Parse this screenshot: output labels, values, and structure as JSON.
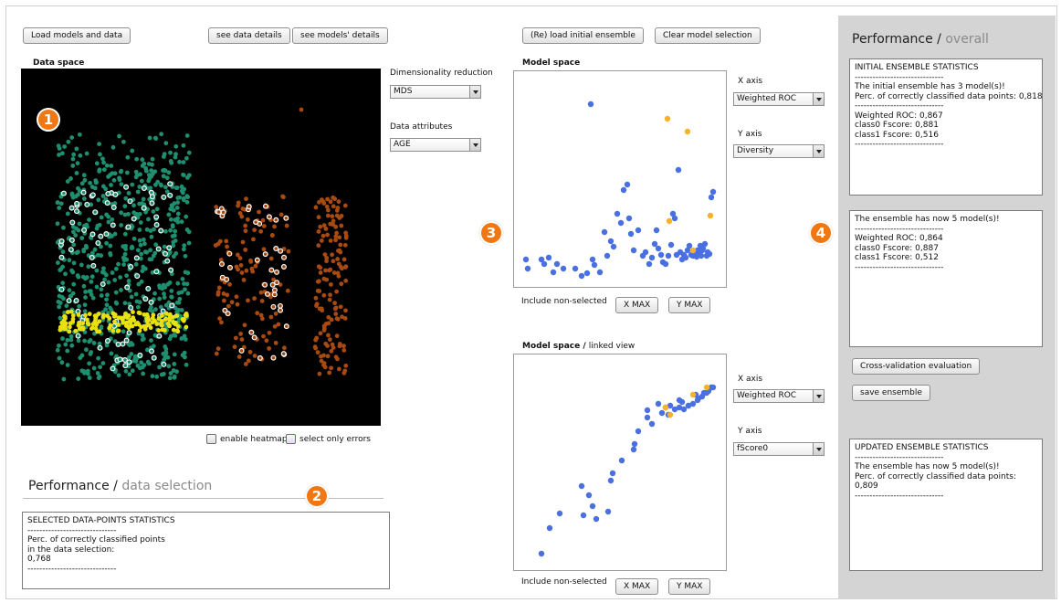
{
  "toolbar": {
    "load_models_data": "Load models and data",
    "see_data_details": "see data details",
    "see_models_details": "see models' details",
    "reload_initial_ensemble": "(Re) load initial ensemble",
    "clear_model_selection": "Clear model selection"
  },
  "data_space": {
    "title": "Data space",
    "dimensionality_label": "Dimensionality reduction",
    "dimensionality_value": "MDS",
    "attributes_label": "Data attributes",
    "attributes_value": "AGE",
    "enable_heatmap": "enable heatmap",
    "select_only_errors": "select only errors"
  },
  "model_space": {
    "title": "Model space",
    "x_axis_label": "X axis",
    "x_axis_value": "Weighted ROC",
    "y_axis_label": "Y axis",
    "y_axis_value": "Diversity",
    "include_non_selected": "Include non-selected",
    "x_max": "X MAX",
    "y_max": "Y MAX"
  },
  "linked_view": {
    "title": "Model space",
    "title_sep": " / ",
    "title_sub": "linked view",
    "x_axis_label": "X axis",
    "x_axis_value": "Weighted ROC",
    "y_axis_label": "Y axis",
    "y_axis_value": "fScore0",
    "include_non_selected": "Include non-selected",
    "x_max": "X MAX",
    "y_max": "Y MAX"
  },
  "performance_selection": {
    "header_main": "Performance",
    "header_sep": " / ",
    "header_sub": "data selection",
    "text": "SELECTED DATA-POINTS STATISTICS\n------------------------------\nPerc. of correctly classified points\nin the data selection:\n0,768\n------------------------------"
  },
  "performance_overall": {
    "header_main": "Performance",
    "header_sep": " / ",
    "header_sub": "overall",
    "initial_text": "INITIAL ENSEMBLE STATISTICS\n------------------------------\nThe initial ensemble has 3 model(s)!\nPerc. of correctly classified data points: 0,818\n------------------------------\nWeighted ROC: 0,867\nclass0 Fscore: 0,881\nclass1 Fscore: 0,516\n------------------------------",
    "current_text": "The ensemble has now 5 model(s)!\n------------------------------\nWeighted ROC: 0,864\nclass0 Fscore: 0,887\nclass1 Fscore: 0,512\n------------------------------",
    "cross_validation": "Cross-validation evaluation",
    "save_ensemble": "save ensemble",
    "updated_text": "UPDATED ENSEMBLE STATISTICS\n------------------------------\nThe ensemble has now 5 model(s)!\nPerc. of correctly classified data points:\n0,809\n------------------------------"
  },
  "markers": {
    "m1": "1",
    "m2": "2",
    "m3": "3",
    "m4": "4"
  },
  "colors": {
    "class_green": "#1e8e6e",
    "class_orange": "#a64a10",
    "selected_yellow": "#e8e010",
    "model_blue": "#4a6fe0",
    "model_selected": "#f5b22a",
    "marker_orange": "#f07814",
    "panel_gray": "#d4d4d4"
  },
  "chart_data": [
    {
      "type": "scatter",
      "title": "Model space",
      "xlabel": "",
      "ylabel": "",
      "series": [
        {
          "name": "",
          "color": "#4a6fe0",
          "x": [
            78,
            7,
            9,
            24,
            27,
            32,
            37,
            41,
            48,
            61,
            68,
            74,
            80,
            82,
            88,
            93,
            96,
            100,
            103,
            107,
            111,
            114,
            118,
            120,
            122,
            125,
            130,
            135,
            138,
            142,
            145,
            148,
            150,
            152,
            155,
            157,
            160,
            163,
            166,
            168,
            170,
            172,
            174,
            176,
            178,
            180,
            182,
            184,
            186,
            188,
            190,
            192,
            194,
            195,
            196,
            197,
            198,
            199,
            200,
            201,
            203,
            205,
            206,
            208,
            210,
            212
          ],
          "y": [
            30,
            200,
            210,
            200,
            205,
            198,
            214,
            205,
            210,
            210,
            218,
            215,
            200,
            206,
            214,
            170,
            196,
            180,
            186,
            150,
            160,
            124,
            118,
            155,
            172,
            190,
            168,
            196,
            192,
            205,
            198,
            183,
            168,
            188,
            195,
            203,
            205,
            196,
            184,
            150,
            155,
            195,
            102,
            192,
            200,
            195,
            198,
            190,
            185,
            195,
            196,
            192,
            197,
            190,
            190,
            195,
            185,
            196,
            190,
            188,
            183,
            196,
            192,
            194,
            132,
            126
          ]
        },
        {
          "name": "",
          "color": "#f5b22a",
          "x": [
            162,
            184,
            164,
            209,
            190
          ],
          "y": [
            46,
            60,
            158,
            152,
            190
          ]
        }
      ]
    },
    {
      "type": "scatter",
      "title": "Model space / linked view",
      "xlabel": "",
      "ylabel": "",
      "series": [
        {
          "name": "",
          "color": "#4a6fe0",
          "x": [
            24,
            33,
            44,
            68,
            76,
            70,
            80,
            84,
            97,
            100,
            102,
            112,
            125,
            126,
            130,
            140,
            145,
            156,
            165,
            170,
            175,
            180,
            185,
            190,
            195,
            200,
            205,
            210,
            140,
            152,
            160,
            175,
            185,
            196,
            202,
            207,
            212,
            163,
            178,
            193
          ],
          "y": [
            212,
            184,
            168,
            138,
            148,
            170,
            160,
            174,
            166,
            132,
            124,
            110,
            98,
            92,
            78,
            63,
            70,
            58,
            50,
            54,
            52,
            54,
            50,
            48,
            44,
            40,
            36,
            30,
            55,
            48,
            52,
            44,
            50,
            42,
            36,
            34,
            30,
            60,
            46,
            38
          ]
        },
        {
          "name": "",
          "color": "#f5b22a",
          "x": [
            160,
            165,
            190,
            205
          ],
          "y": [
            52,
            60,
            38,
            30
          ]
        }
      ]
    }
  ]
}
